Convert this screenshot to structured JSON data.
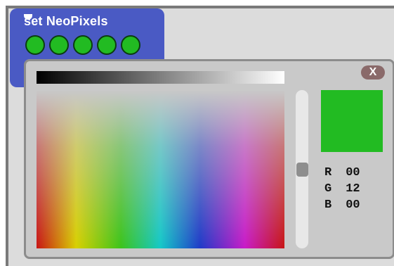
{
  "block": {
    "title": "set NeoPixels"
  },
  "neopixels": [
    {
      "color": "#22bb22"
    },
    {
      "color": "#22bb22"
    },
    {
      "color": "#22bb22"
    },
    {
      "color": "#22bb22"
    },
    {
      "color": "#22bb22"
    }
  ],
  "color_picker": {
    "close_label": "X",
    "selected_color": "#22bb22",
    "rgb": [
      {
        "label": "R",
        "value": "00"
      },
      {
        "label": "G",
        "value": "12"
      },
      {
        "label": "B",
        "value": "00"
      }
    ],
    "brightness_slider_value": 0.53
  }
}
